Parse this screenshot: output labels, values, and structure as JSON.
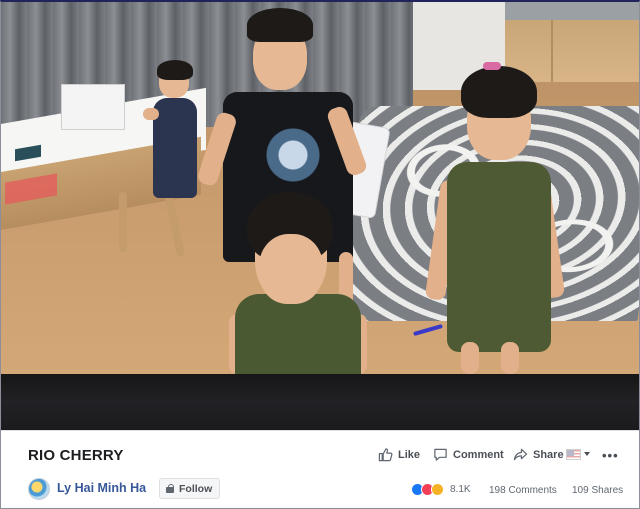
{
  "video": {
    "title": "RIO CHERRY"
  },
  "author": {
    "name": "Ly Hai Minh Ha",
    "follow_label": "Follow"
  },
  "actions": {
    "like_label": "Like",
    "comment_label": "Comment",
    "share_label": "Share",
    "more_label": "•••"
  },
  "stats": {
    "reactions_count": "8.1K",
    "comments": "198 Comments",
    "shares": "109 Shares",
    "reaction_icons": [
      "like-icon",
      "love-icon",
      "haha-icon"
    ]
  },
  "colors": {
    "link": "#365899",
    "like": "#1877f2",
    "love": "#f33e58",
    "haha": "#f7b125"
  }
}
